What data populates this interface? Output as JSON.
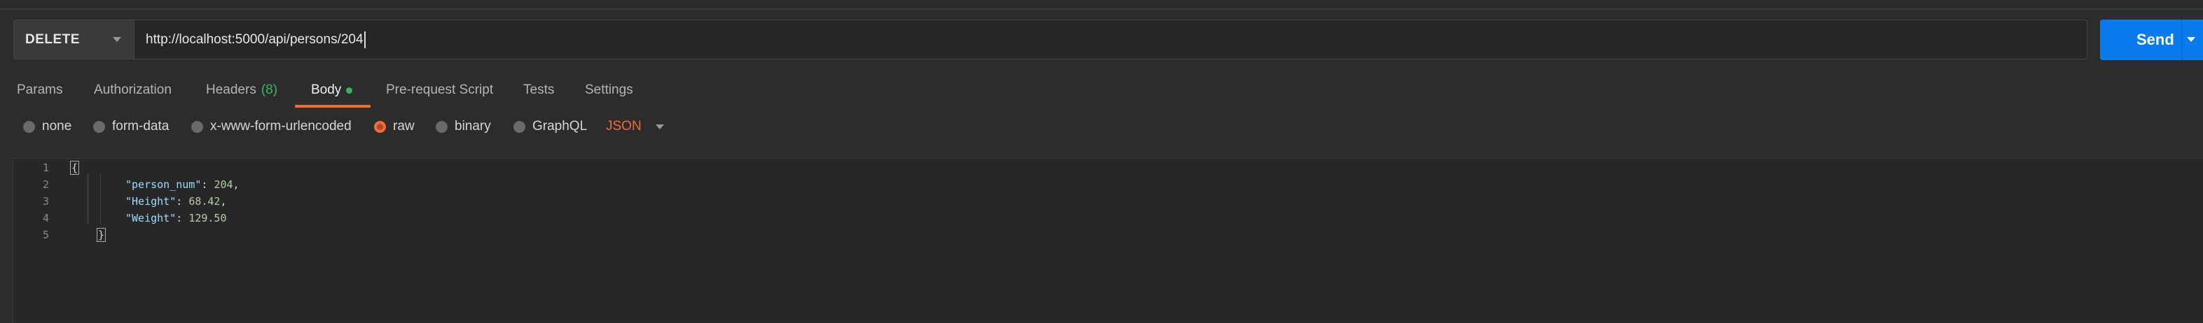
{
  "request": {
    "method": "DELETE",
    "url": "http://localhost:5000/api/persons/204",
    "send_label": "Send"
  },
  "tabs": [
    {
      "label": "Params"
    },
    {
      "label": "Authorization"
    },
    {
      "label": "Headers",
      "count": "(8)"
    },
    {
      "label": "Body",
      "active": true
    },
    {
      "label": "Pre-request Script"
    },
    {
      "label": "Tests"
    },
    {
      "label": "Settings"
    }
  ],
  "body_types": [
    {
      "label": "none"
    },
    {
      "label": "form-data"
    },
    {
      "label": "x-www-form-urlencoded"
    },
    {
      "label": "raw",
      "selected": true
    },
    {
      "label": "binary"
    },
    {
      "label": "GraphQL"
    }
  ],
  "raw_language": "JSON",
  "editor": {
    "line_numbers": [
      "1",
      "2",
      "3",
      "4",
      "5"
    ],
    "open_brace": "{",
    "close_brace": "}",
    "fields": [
      {
        "key": "\"person_num\"",
        "value": "204",
        "trail": ","
      },
      {
        "key": "\"Height\"",
        "value": "68.42",
        "trail": ","
      },
      {
        "key": "\"Weight\"",
        "value": "129.50",
        "trail": ""
      }
    ]
  },
  "colors": {
    "accent": "#f26b3a",
    "send": "#097bed",
    "status_dot": "#37b360"
  }
}
